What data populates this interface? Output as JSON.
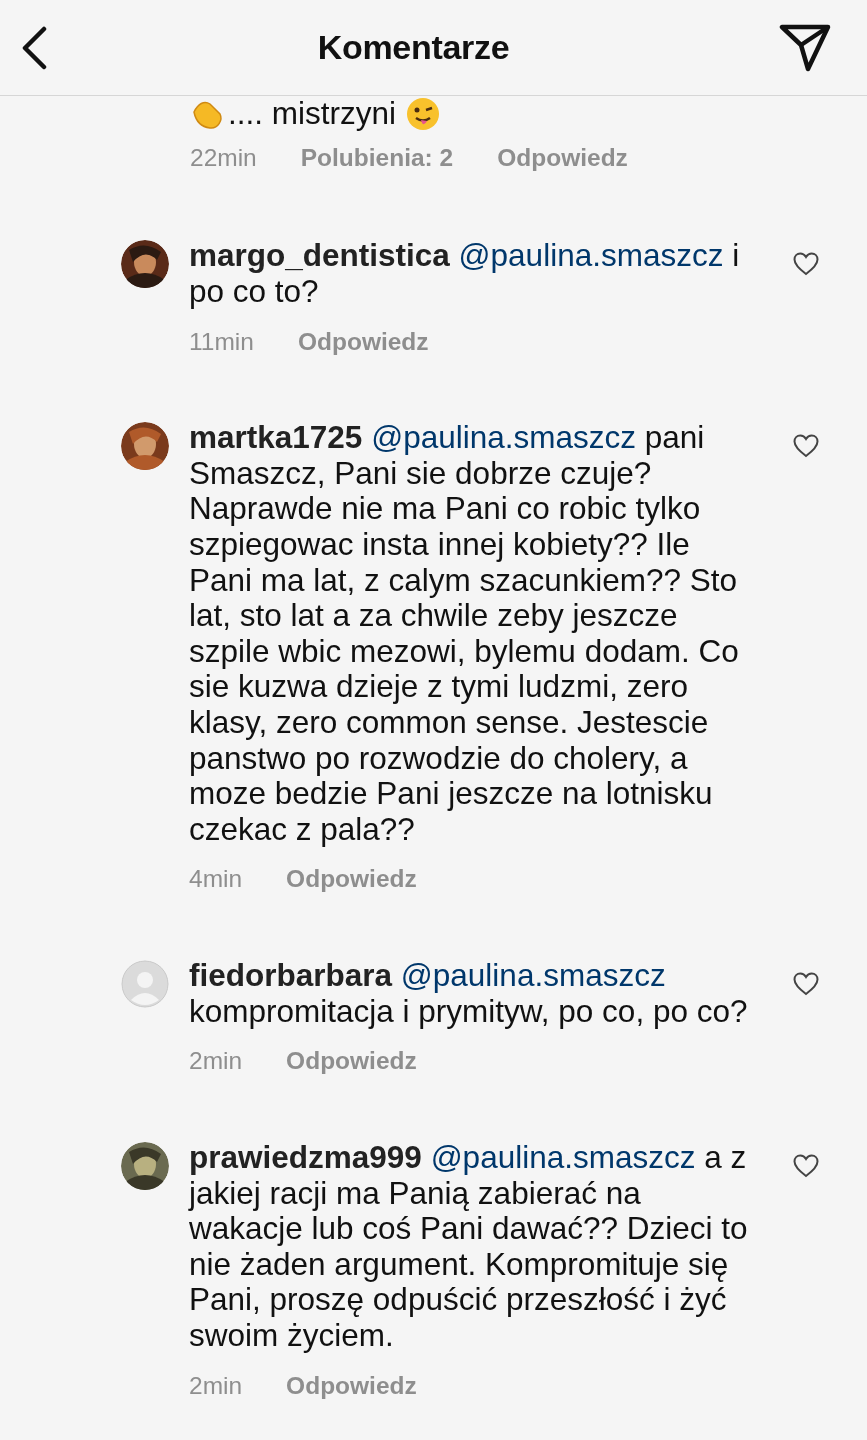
{
  "header": {
    "title": "Komentarze"
  },
  "partial_comment": {
    "text": ".... mistrzyni",
    "time": "22min",
    "likes": "Polubienia: 2",
    "reply": "Odpowiedz"
  },
  "comments": [
    {
      "username": "margo_dentistica",
      "mention": "@paulina.smaszcz",
      "text": " i po co to?",
      "time": "11min",
      "reply": "Odpowiedz",
      "liked": false
    },
    {
      "username": "martka1725",
      "mention": "@paulina.smaszcz",
      "text": " pani Smaszcz, Pani sie dobrze czuje? Naprawde nie ma Pani co robic tylko szpiegowac insta innej kobiety?? Ile Pani ma lat, z calym szacunkiem?? Sto lat, sto lat a za chwile zeby jeszcze szpile wbic mezowi, bylemu dodam. Co sie kuzwa dzieje z tymi ludzmi, zero klasy, zero common sense. Jestescie panstwo po rozwodzie do cholery, a moze bedzie Pani jeszcze na lotnisku czekac z pala??",
      "time": "4min",
      "reply": "Odpowiedz",
      "liked": false
    },
    {
      "avatar": {
        "kind": "default"
      },
      "username": "fiedorbarbara",
      "mention": "@paulina.smaszcz",
      "text": " kompromitacja i prymityw, po co, po co?",
      "time": "2min",
      "reply": "Odpowiedz",
      "liked": false
    },
    {
      "username": "prawiedzma999",
      "mention": "@paulina.smaszcz",
      "text": " a z jakiej racji ma Panią zabierać na wakacje lub coś Pani dawać?? Dzieci to nie żaden argument. Kompromituje się Pani, proszę odpuścić przeszłość i żyć swoim życiem.",
      "time": "2min",
      "reply": "Odpowiedz",
      "liked": false
    }
  ]
}
